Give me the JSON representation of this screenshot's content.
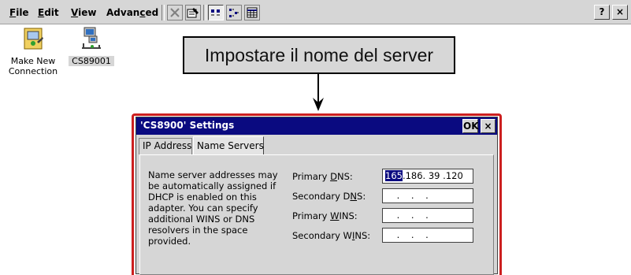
{
  "menu": {
    "file": {
      "u": "F",
      "rest": "ile"
    },
    "edit": {
      "u": "E",
      "rest": "dit"
    },
    "view": {
      "u": "V",
      "rest": "iew"
    },
    "advanced": {
      "pre": "Advan",
      "u": "c",
      "rest": "ed"
    },
    "help_label": "?",
    "close_label": "×"
  },
  "desktop": {
    "make_new_connection": "Make New Connection",
    "cs89001": "CS89001"
  },
  "callout": {
    "text": "Impostare il nome del server"
  },
  "dialog": {
    "title": "'CS8900' Settings",
    "ok_label": "OK",
    "close_label": "×",
    "tabs": [
      "IP Address",
      "Name Servers"
    ],
    "active_tab": "Name Servers",
    "description": "Name server addresses may be automatically assigned if DHCP is enabled on this adapter. You can specify additional WINS or DNS resolvers in the space provided.",
    "fields": [
      {
        "pre": "Primary ",
        "u": "D",
        "post": "NS:",
        "value_hl": "165",
        "value_rest": ".186. 39 .120"
      },
      {
        "pre": "Secondary D",
        "u": "N",
        "post": "S:",
        "value_hl": "",
        "value_rest": "    .    .    ."
      },
      {
        "pre": "Primary ",
        "u": "W",
        "post": "INS:",
        "value_hl": "",
        "value_rest": "    .    .    ."
      },
      {
        "pre": "Secondary W",
        "u": "I",
        "post": "NS:",
        "value_hl": "",
        "value_rest": "    .    .    ."
      }
    ]
  },
  "colors": {
    "title_bar": "#0a0a80",
    "highlight_frame": "#cc1f1f",
    "dialog_bg": "#d6d6d6"
  }
}
